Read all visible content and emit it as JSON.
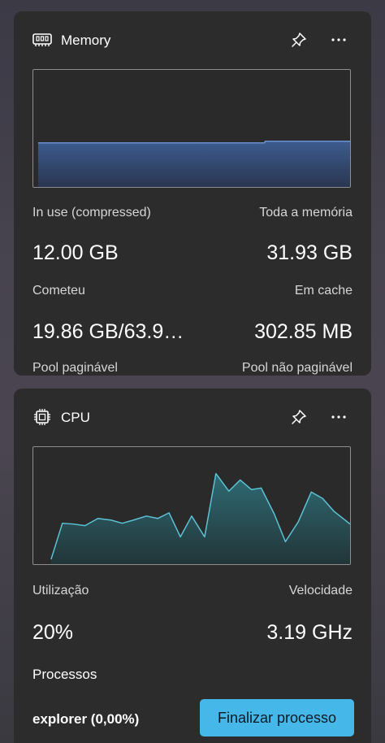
{
  "memory": {
    "title": "Memory",
    "in_use_label": "In use (compressed)",
    "in_use_value": "12.00 GB",
    "total_label": "Toda a memória",
    "total_value": "31.93 GB",
    "committed_label": "Cometeu",
    "committed_value": "19.86 GB/63.9…",
    "cached_label": "Em cache",
    "cached_value": "302.85 MB",
    "paged_pool_label": "Pool paginável",
    "nonpaged_pool_label": "Pool não paginável"
  },
  "cpu": {
    "title": "CPU",
    "utilization_label": "Utilização",
    "utilization_value": "20%",
    "speed_label": "Velocidade",
    "speed_value": "3.19 GHz",
    "processes_label": "Processos",
    "top_process": "explorer (0,00%)",
    "end_task_label": "Finalizar processo"
  },
  "colors": {
    "widget_bg": "#2c2c2c",
    "memory_graph_line": "#6d8fd0",
    "cpu_graph_line": "#5cc3d6",
    "accent_button": "#46b7e9"
  },
  "icons": {
    "memory": "ram-chip-icon",
    "cpu": "processor-chip-icon",
    "pin": "pin-icon",
    "more": "more-options-icon"
  }
}
